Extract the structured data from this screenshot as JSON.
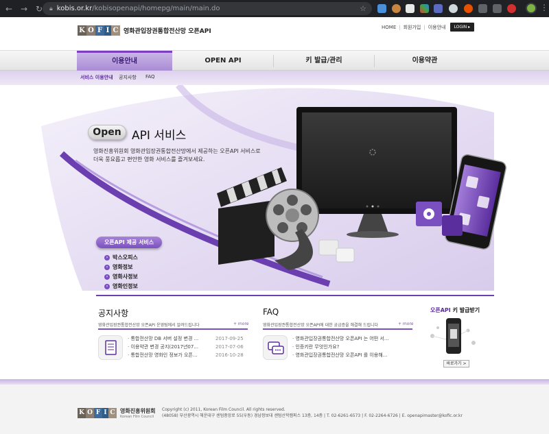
{
  "browser": {
    "url_host": "kobis.or.kr",
    "url_path": "/kobisopenapi/homepg/main/main.do"
  },
  "header": {
    "logo_letters": [
      "K",
      "O",
      "F",
      "I",
      "C"
    ],
    "site_title": "영화관입장권통합전산망 오픈API",
    "top_links": [
      "HOME",
      "회원가입",
      "이용안내"
    ],
    "login_label": "LOGIN"
  },
  "mainnav": {
    "items": [
      "이용안내",
      "OPEN API",
      "키 발급/관리",
      "이용약관"
    ]
  },
  "subnav": {
    "items": [
      "서비스 이용안내",
      "공지사항",
      "FAQ"
    ]
  },
  "hero": {
    "open_label": "Open",
    "title": "API 서비스",
    "desc_line1": "영화진흥위원회 영화관입장권통합전산망에서 제공하는 오픈API 서비스로",
    "desc_line2": "더욱 풍요롭고 편안한 영화 서비스를 즐겨보세요.",
    "service_label": "오픈API 제공 서비스",
    "services": [
      "박스오피스",
      "영화정보",
      "영화사정보",
      "영화인정보"
    ]
  },
  "notice": {
    "title": "공지사항",
    "desc": "영화관입장권통합전산망 오픈API 운영팀에서 알려드립니다",
    "more": "+ more",
    "items": [
      {
        "text": "· 통합전산망 DB 서버 설정 변경 ...",
        "date": "2017-09-25"
      },
      {
        "text": "· 이용약관 변경 공지(2017년07...",
        "date": "2017-07-06"
      },
      {
        "text": "· 통합전산망 영화인 정보가 오픈...",
        "date": "2016-10-28"
      }
    ]
  },
  "faq": {
    "title": "FAQ",
    "desc": "영화관입장권통합전산망 오픈API에 대한 궁금증을 해결해 드립니다",
    "more": "+ more",
    "items": [
      "· 영화관입장권통합전산망 오픈API 는 어떤 서...",
      "· 인증키란 무엇인가요?",
      "· 영화관입장권통합전산망 오픈API 를 이용해..."
    ]
  },
  "key": {
    "title_a": "오픈API",
    "title_b": "키 발급받기",
    "button": "바로가기 >"
  },
  "footer": {
    "org_name": "영화진흥위원회",
    "org_name_en": "Korean Film Council",
    "line1": "Copyright (c) 2011, Korean Film Council. All rights reserved.",
    "line2": "(48058) 부산광역시 해운대구 센텀중앙로 55(우동) 경남정보대 센텀산학캠퍼스 13층, 14층 | T. 02-6261-6573 | F. 02-2264-6726 | E. openapimaster@kofic.or.kr"
  },
  "colors": {
    "accent": "#7a4fc0",
    "logo_k": "#6b6157",
    "logo_o": "#8a7d70",
    "logo_f": "#3d6b9c",
    "logo_i": "#2f5d87",
    "logo_c": "#a0907d"
  }
}
